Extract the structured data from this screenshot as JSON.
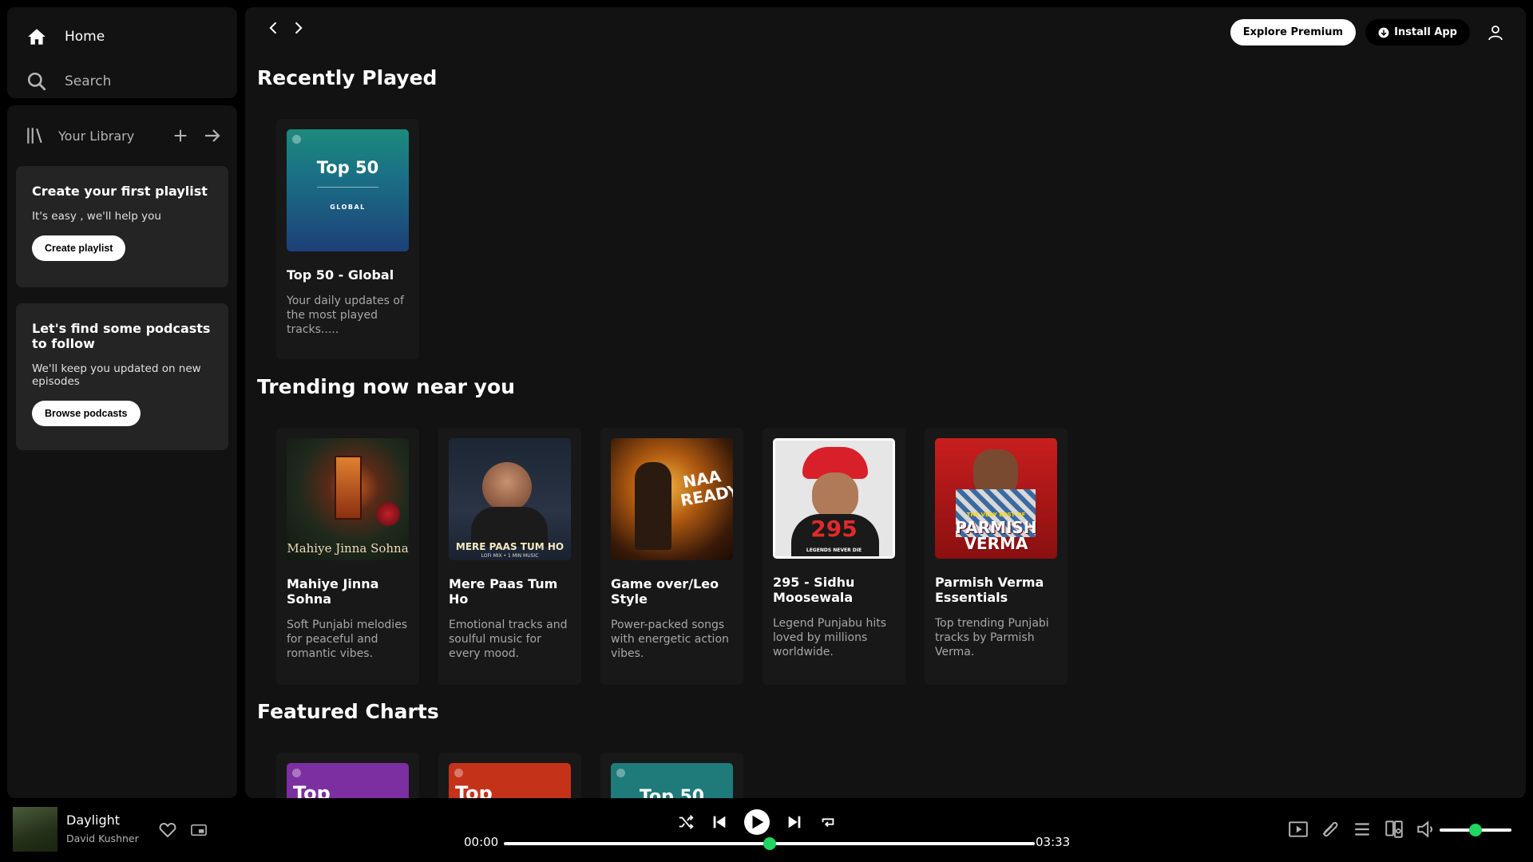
{
  "sidebar": {
    "home_label": "Home",
    "search_label": "Search",
    "library_title": "Your Library",
    "playlist_card": {
      "title": "Create your first playlist",
      "text": "It's easy , we'll help you",
      "button": "Create playlist"
    },
    "podcast_card": {
      "title": "Let's find some podcasts to follow",
      "text": "We'll keep you updated on new episodes",
      "button": "Browse podcasts"
    }
  },
  "header": {
    "premium_label": "Explore Premium",
    "install_label": "Install App"
  },
  "sections": {
    "recent": {
      "title": "Recently Played",
      "items": [
        {
          "art_title": "Top 50",
          "art_subtitle": "GLOBAL",
          "title": "Top 50 - Global",
          "desc": "Your daily updates of the most played tracks....."
        }
      ]
    },
    "trending": {
      "title": "Trending now near you",
      "items": [
        {
          "title": "Mahiye Jinna Sohna",
          "desc": "Soft Punjabi melodies for peaceful and romantic vibes.",
          "art_text": "Mahiye Jinna Sohna"
        },
        {
          "title": "Mere Paas Tum Ho",
          "desc": "Emotional tracks and soulful music for every mood.",
          "art_text": "MERE PAAS TUM HO",
          "art_subtext": "LOFI MIX • 1 MIN MUSIC"
        },
        {
          "title": "Game over/Leo Style",
          "desc": "Power-packed songs with energetic action vibes.",
          "art_text": "NAA READY"
        },
        {
          "title": "295 - Sidhu Moosewala",
          "desc": "Legend Punjabu hits loved by millions worldwide.",
          "art_text": "295",
          "art_subtext": "LEGENDS NEVER DIE"
        },
        {
          "title": "Parmish Verma Essentials",
          "desc": "Top trending Punjabi tracks by Parmish Verma.",
          "art_text": "PARMISH VERMA",
          "art_subtext": "THE VERY BEST OF"
        }
      ]
    },
    "featured": {
      "title": "Featured Charts",
      "items": [
        {
          "art_title": "Top",
          "color": "#7b2fa0"
        },
        {
          "art_title": "Top",
          "color": "#c4321a"
        },
        {
          "art_title": "Top 50",
          "color": "#1f7a7a"
        }
      ]
    }
  },
  "player": {
    "track": "Daylight",
    "artist": "David Kushner",
    "current_time": "00:00",
    "total_time": "03:33",
    "progress_fraction": 0.5,
    "volume_fraction": 0.5
  },
  "colors": {
    "accent": "#1ed760",
    "panel": "#121212",
    "card": "#181818"
  }
}
